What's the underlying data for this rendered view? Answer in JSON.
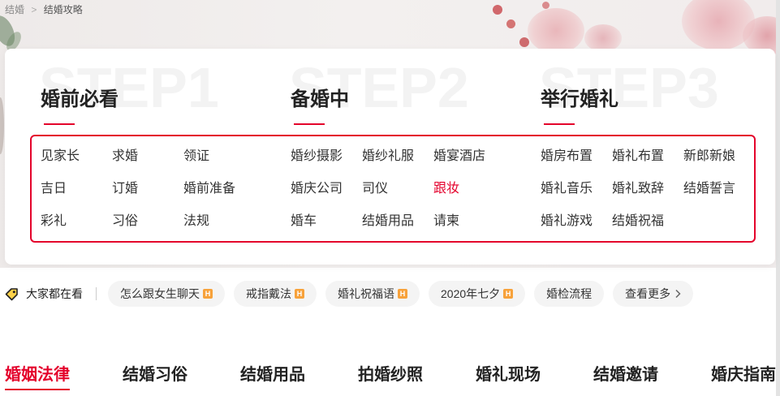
{
  "colors": {
    "accent": "#e4002b",
    "hot_badge": "#f7a23b",
    "text": "#222222",
    "pill_bg": "#f4f4f4"
  },
  "breadcrumb": {
    "home": "结婚",
    "separator": ">",
    "current": "结婚攻略"
  },
  "guide": {
    "columns": [
      {
        "watermark": "STEP1",
        "title": "婚前必看",
        "rows": [
          [
            {
              "label": "见家长"
            },
            {
              "label": "求婚"
            },
            {
              "label": "领证"
            }
          ],
          [
            {
              "label": "吉日"
            },
            {
              "label": "订婚"
            },
            {
              "label": "婚前准备"
            }
          ],
          [
            {
              "label": "彩礼"
            },
            {
              "label": "习俗"
            },
            {
              "label": "法规"
            }
          ]
        ]
      },
      {
        "watermark": "STEP2",
        "title": "备婚中",
        "rows": [
          [
            {
              "label": "婚纱摄影"
            },
            {
              "label": "婚纱礼服"
            },
            {
              "label": "婚宴酒店"
            }
          ],
          [
            {
              "label": "婚庆公司"
            },
            {
              "label": "司仪"
            },
            {
              "label": "跟妆",
              "highlighted": true
            }
          ],
          [
            {
              "label": "婚车"
            },
            {
              "label": "结婚用品"
            },
            {
              "label": "请柬"
            }
          ]
        ]
      },
      {
        "watermark": "STEP3",
        "title": "举行婚礼",
        "rows": [
          [
            {
              "label": "婚房布置"
            },
            {
              "label": "婚礼布置"
            },
            {
              "label": "新郎新娘"
            }
          ],
          [
            {
              "label": "婚礼音乐"
            },
            {
              "label": "婚礼致辞"
            },
            {
              "label": "结婚誓言"
            }
          ],
          [
            {
              "label": "婚礼游戏"
            },
            {
              "label": "结婚祝福"
            }
          ]
        ]
      }
    ]
  },
  "trending": {
    "icon": "tag-icon",
    "label": "大家都在看",
    "hot_badge": "H",
    "tags": [
      {
        "label": "怎么跟女生聊天",
        "hot": true
      },
      {
        "label": "戒指戴法",
        "hot": true
      },
      {
        "label": "婚礼祝福语",
        "hot": true
      },
      {
        "label": "2020年七夕",
        "hot": true
      },
      {
        "label": "婚检流程",
        "hot": false
      }
    ],
    "more_label": "查看更多",
    "more_icon": "chevron-right-icon"
  },
  "category_tabs": [
    {
      "label": "婚姻法律",
      "active": true
    },
    {
      "label": "结婚习俗",
      "active": false
    },
    {
      "label": "结婚用品",
      "active": false
    },
    {
      "label": "拍婚纱照",
      "active": false
    },
    {
      "label": "婚礼现场",
      "active": false
    },
    {
      "label": "结婚邀请",
      "active": false
    },
    {
      "label": "婚庆指南",
      "active": false
    }
  ]
}
